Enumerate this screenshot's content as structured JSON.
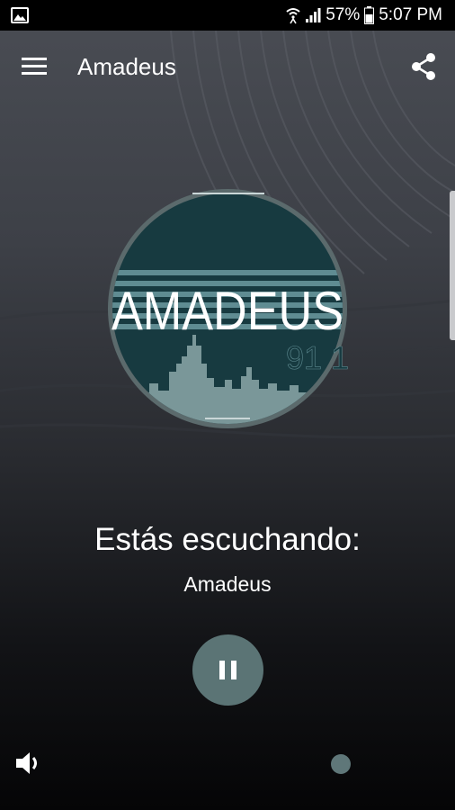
{
  "status_bar": {
    "battery_percent": "57%",
    "time": "5:07 PM"
  },
  "app_bar": {
    "title": "Amadeus",
    "menu_icon": "hamburger-menu-icon",
    "share_icon": "share-icon"
  },
  "station_logo": {
    "brand_text": "AMADEUS",
    "frequency_text": "91 1",
    "colors": {
      "background": "#173a40",
      "stripes": "#5f8c92",
      "skyline": "#7a9799",
      "ring": "#5b6a6c"
    }
  },
  "player": {
    "now_playing_label": "Estás escuchando:",
    "station_name": "Amadeus",
    "state": "playing",
    "pause_icon": "pause-icon",
    "button_color": "#5b7475"
  },
  "volume": {
    "icon": "volume-icon",
    "level": 0.76
  }
}
